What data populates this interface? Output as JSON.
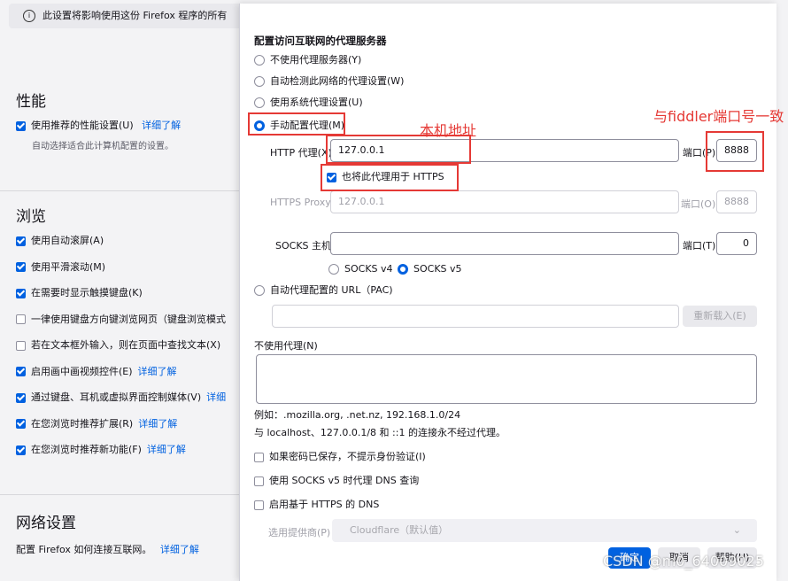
{
  "settings": {
    "infobar": "此设置将影响使用这份 Firefox 程序的所有",
    "perf_heading": "性能",
    "perf_recommended": "使用推荐的性能设置(U)",
    "perf_learn": "详细了解",
    "perf_sub": "自动选择适合此计算机配置的设置。",
    "browse_heading": "浏览",
    "browse_items": [
      {
        "label": "使用自动滚屏(A)",
        "checked": true,
        "link": ""
      },
      {
        "label": "使用平滑滚动(M)",
        "checked": true,
        "link": ""
      },
      {
        "label": "在需要时显示触摸键盘(K)",
        "checked": true,
        "link": ""
      },
      {
        "label": "一律使用键盘方向键浏览网页（键盘浏览模式",
        "checked": false,
        "link": ""
      },
      {
        "label": "若在文本框外输入，则在页面中查找文本(X)",
        "checked": false,
        "link": ""
      },
      {
        "label": "启用画中画视频控件(E)",
        "checked": true,
        "link": "详细了解"
      },
      {
        "label": "通过键盘、耳机或虚拟界面控制媒体(V)",
        "checked": true,
        "link": "详细"
      },
      {
        "label": "在您浏览时推荐扩展(R)",
        "checked": true,
        "link": "详细了解"
      },
      {
        "label": "在您浏览时推荐新功能(F)",
        "checked": true,
        "link": "详细了解"
      }
    ],
    "network_heading": "网络设置",
    "network_desc": "配置 Firefox 如何连接互联网。",
    "network_learn": "详细了解"
  },
  "dialog": {
    "title": "配置访问互联网的代理服务器",
    "opt_none": "不使用代理服务器(Y)",
    "opt_auto": "自动检测此网络的代理设置(W)",
    "opt_system": "使用系统代理设置(U)",
    "opt_manual": "手动配置代理(M)",
    "http_label": "HTTP 代理(X)",
    "http_value": "127.0.0.1",
    "port_label": "端口(P)",
    "http_port": "8888",
    "https_also": "也将此代理用于 HTTPS",
    "https_label": "HTTPS Proxy",
    "https_value": "127.0.0.1",
    "https_port_label": "端口(O)",
    "https_port": "8888",
    "socks_label": "SOCKS 主机",
    "socks_value": "",
    "socks_port_label": "端口(T)",
    "socks_port": "0",
    "socks_v4": "SOCKS v4",
    "socks_v5": "SOCKS v5",
    "opt_pac": "自动代理配置的 URL（PAC)",
    "pac_value": "",
    "reload": "重新载入(E)",
    "no_proxy_label": "不使用代理(N)",
    "no_proxy_value": "",
    "example": "例如：.mozilla.org, .net.nz, 192.168.1.0/24",
    "localhost_note": "与 localhost、127.0.0.1/8 和 ::1 的连接永不经过代理。",
    "cb_no_auth": "如果密码已保存，不提示身份验证(I)",
    "cb_socks_dns": "使用 SOCKS v5 时代理 DNS 查询",
    "cb_doh": "启用基于 HTTPS 的 DNS",
    "provider_label": "选用提供商(P)",
    "provider_value": "Cloudflare（默认值）",
    "ok": "确定",
    "cancel": "取消",
    "help": "帮助(H)"
  },
  "annotations": {
    "local_addr": "本机地址",
    "port_same": "与fiddler端口号一致",
    "watermark": "CSDN @m0_64009025"
  },
  "colors": {
    "accent": "#0061e0",
    "annotation": "#e53935"
  }
}
